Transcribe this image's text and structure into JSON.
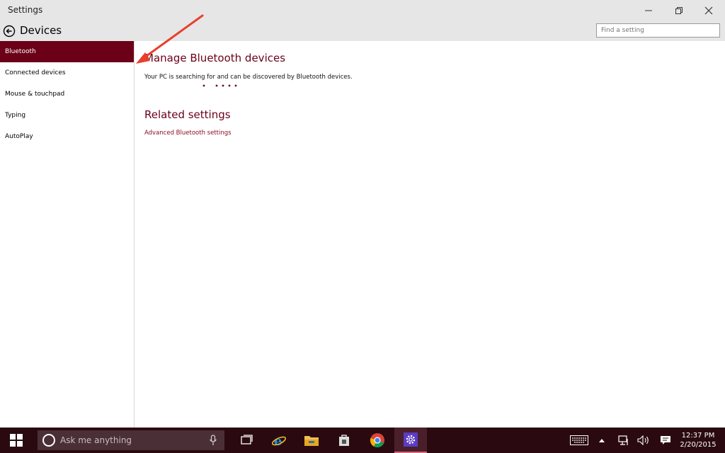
{
  "window": {
    "title": "Settings",
    "controls": [
      "minimize-icon",
      "restore-icon",
      "close-icon"
    ]
  },
  "header": {
    "back_icon": "back-arrow-circle-icon",
    "heading": "Devices",
    "search_placeholder": "Find a setting"
  },
  "sidebar": {
    "items": [
      {
        "label": "Bluetooth",
        "active": true
      },
      {
        "label": "Connected devices",
        "active": false
      },
      {
        "label": "Mouse & touchpad",
        "active": false
      },
      {
        "label": "Typing",
        "active": false
      },
      {
        "label": "AutoPlay",
        "active": false
      }
    ]
  },
  "main": {
    "section_title": "Manage Bluetooth devices",
    "description": "Your PC is searching for and can be discovered by Bluetooth devices.",
    "related_title": "Related settings",
    "related_link": "Advanced Bluetooth settings"
  },
  "taskbar": {
    "search_placeholder": "Ask me anything",
    "apps": [
      "task-view-icon",
      "internet-explorer-icon",
      "file-explorer-icon",
      "store-icon",
      "chrome-icon",
      "settings-icon"
    ],
    "tray": [
      "keyboard-icon",
      "show-hidden-icons-chevron",
      "network-icon",
      "volume-icon",
      "action-center-icon"
    ],
    "time": "12:37 PM",
    "date": "2/20/2015"
  },
  "colors": {
    "accent": "#6b0018",
    "accent_text": "#6b0018",
    "chrome": "#e6e6e6",
    "taskbar": "#2a0a10",
    "annotation_arrow": "#e8402e"
  }
}
